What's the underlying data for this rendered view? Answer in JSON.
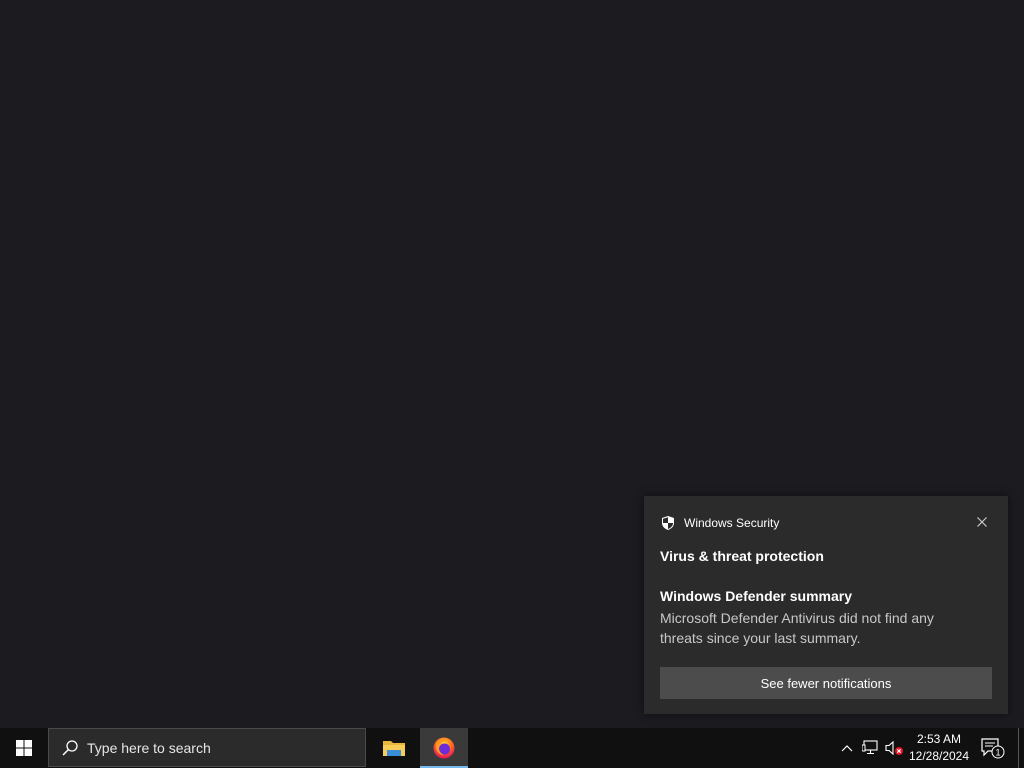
{
  "toast": {
    "app_name": "Windows Security",
    "title": "Virus & threat protection",
    "subtitle": "Windows Defender summary",
    "body": "Microsoft Defender Antivirus did not find any threats since your last summary.",
    "button_label": "See fewer notifications"
  },
  "taskbar": {
    "search_placeholder": "Type here to search",
    "apps": [
      {
        "name": "File Explorer",
        "icon": "folder-icon"
      },
      {
        "name": "Firefox",
        "icon": "firefox-icon",
        "active": true
      }
    ],
    "clock": {
      "time": "2:53 AM",
      "date": "12/28/2024"
    },
    "notification_count": "1"
  },
  "colors": {
    "desktop_background": "#1c1b20",
    "taskbar_background": "#101010",
    "toast_background": "#2b2b2b",
    "toast_button": "#4c4c4c",
    "active_indicator": "#76b9ed"
  }
}
